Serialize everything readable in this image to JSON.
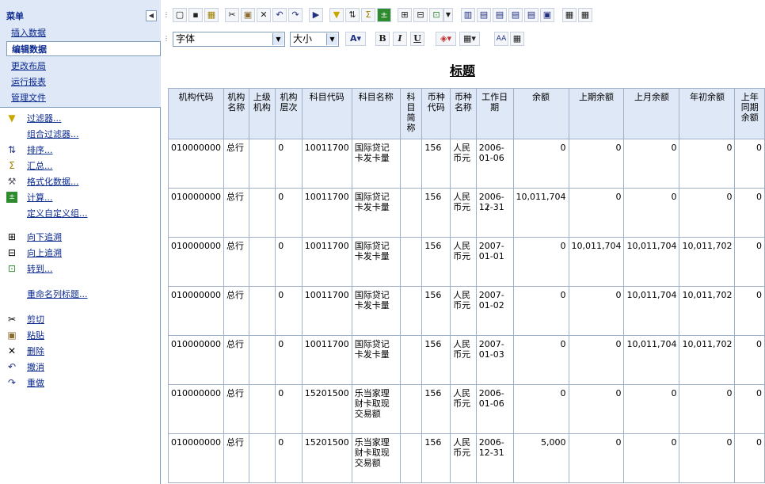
{
  "menu": {
    "title": "菜单",
    "items": [
      {
        "label": "插入数据"
      },
      {
        "label": "编辑数据"
      },
      {
        "label": "更改布局"
      },
      {
        "label": "运行报表"
      },
      {
        "label": "管理文件"
      }
    ]
  },
  "actions": [
    {
      "label": "过滤器...",
      "icon": "filter-icon"
    },
    {
      "label": "组合过滤器...",
      "icon": ""
    },
    {
      "label": "排序...",
      "icon": "sort-icon"
    },
    {
      "label": "汇总...",
      "icon": "sum-icon"
    },
    {
      "label": "格式化数据...",
      "icon": "format-icon"
    },
    {
      "label": "计算...",
      "icon": "calculate-icon"
    },
    {
      "label": "定义自定义组...",
      "icon": ""
    },
    {
      "label": "向下追溯",
      "icon": "drill-down-icon"
    },
    {
      "label": "向上追溯",
      "icon": "drill-up-icon"
    },
    {
      "label": "转到...",
      "icon": "goto-icon"
    },
    {
      "label": "重命名列标题...",
      "icon": ""
    },
    {
      "label": "剪切",
      "icon": "cut-icon"
    },
    {
      "label": "粘贴",
      "icon": "paste-icon"
    },
    {
      "label": "删除",
      "icon": "delete-icon"
    },
    {
      "label": "撤消",
      "icon": "undo-icon"
    },
    {
      "label": "重做",
      "icon": "redo-icon"
    }
  ],
  "format_toolbar": {
    "font_value": "字体",
    "size_value": "大小",
    "bold": "B",
    "italic": "I",
    "underline": "U"
  },
  "report": {
    "title": "标题",
    "columns": [
      "机构代码",
      "机构名称",
      "上级机构",
      "机构层次",
      "科目代码",
      "科目名称",
      "科目简称",
      "币种代码",
      "币种名称",
      "工作日期",
      "余额",
      "上期余额",
      "上月余额",
      "年初余额",
      "上年同期余额"
    ],
    "rows": [
      [
        "010000000",
        "总行",
        "",
        "0",
        "10011700",
        "国际贷记卡发卡量",
        "",
        "156",
        "人民币元",
        "2006-01-06",
        "0",
        "0",
        "0",
        "0",
        "0"
      ],
      [
        "010000000",
        "总行",
        "",
        "0",
        "10011700",
        "国际贷记卡发卡量",
        "",
        "156",
        "人民币元",
        "2006-12-31",
        "10,011,704",
        "0",
        "0",
        "0",
        "0"
      ],
      [
        "010000000",
        "总行",
        "",
        "0",
        "10011700",
        "国际贷记卡发卡量",
        "",
        "156",
        "人民币元",
        "2007-01-01",
        "0",
        "10,011,704",
        "10,011,704",
        "10,011,702",
        "0"
      ],
      [
        "010000000",
        "总行",
        "",
        "0",
        "10011700",
        "国际贷记卡发卡量",
        "",
        "156",
        "人民币元",
        "2007-01-02",
        "0",
        "0",
        "10,011,704",
        "10,011,702",
        "0"
      ],
      [
        "010000000",
        "总行",
        "",
        "0",
        "10011700",
        "国际贷记卡发卡量",
        "",
        "156",
        "人民币元",
        "2007-01-03",
        "0",
        "0",
        "10,011,704",
        "10,011,702",
        "0"
      ],
      [
        "010000000",
        "总行",
        "",
        "0",
        "15201500",
        "乐当家理财卡取现交易额",
        "",
        "156",
        "人民币元",
        "2006-01-06",
        "0",
        "0",
        "0",
        "0",
        "0"
      ],
      [
        "010000000",
        "总行",
        "",
        "0",
        "15201500",
        "乐当家理财卡取现交易额",
        "",
        "156",
        "人民币元",
        "2006-12-31",
        "5,000",
        "0",
        "0",
        "0",
        "0"
      ]
    ]
  }
}
